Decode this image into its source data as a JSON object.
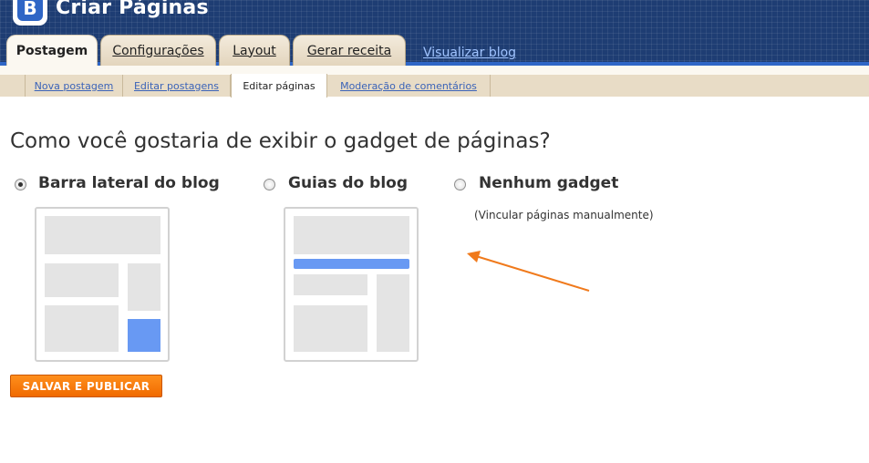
{
  "header": {
    "title": "Criar Páginas",
    "logo_letter": "B"
  },
  "main_tabs": [
    {
      "label": "Postagem",
      "active": true
    },
    {
      "label": "Configurações"
    },
    {
      "label": "Layout"
    },
    {
      "label": "Gerar receita"
    }
  ],
  "view_blog_link": "Visualizar blog",
  "sub_tabs": [
    {
      "label": "Nova postagem"
    },
    {
      "label": "Editar postagens"
    },
    {
      "label": "Editar páginas",
      "active": true
    },
    {
      "label": "Moderação de comentários"
    }
  ],
  "content": {
    "question": "Como você gostaria de exibir o gadget de páginas?",
    "options": [
      {
        "label": "Barra lateral do blog",
        "checked": true
      },
      {
        "label": "Guias do blog",
        "checked": false
      },
      {
        "label": "Nenhum gadget",
        "checked": false,
        "note": "(Vincular páginas manualmente)"
      }
    ],
    "save_button": "SALVAR E PUBLICAR"
  },
  "colors": {
    "header_bg": "#1e3d73",
    "accent_blue": "#6899f3",
    "save_orange": "#f06a00",
    "arrow_orange": "#f07a1c"
  },
  "icons": {
    "logo": "blogger-logo-icon",
    "arrow": "annotation-arrow-icon"
  }
}
